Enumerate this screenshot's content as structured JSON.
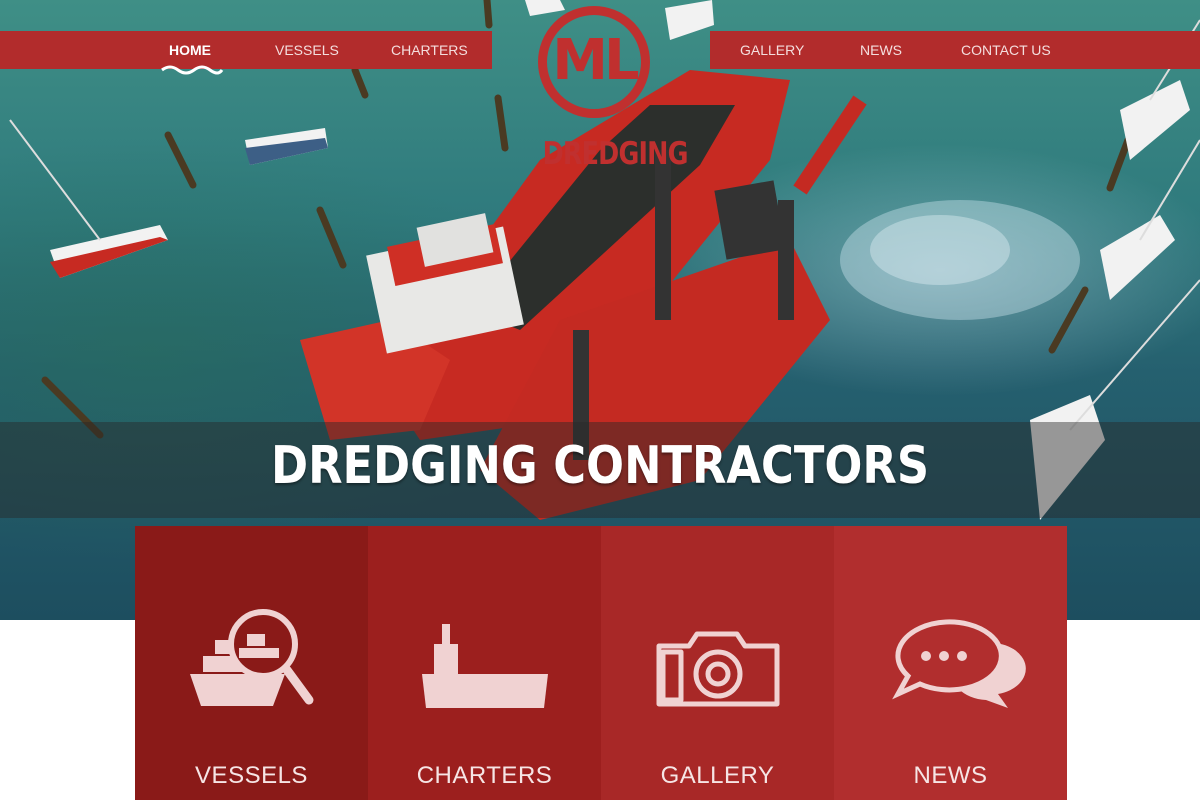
{
  "nav": {
    "left": [
      {
        "label": "HOME",
        "active": true
      },
      {
        "label": "VESSELS"
      },
      {
        "label": "CHARTERS"
      }
    ],
    "right": [
      {
        "label": "GALLERY"
      },
      {
        "label": "NEWS"
      },
      {
        "label": "CONTACT US"
      }
    ]
  },
  "logo": {
    "initials": "ML",
    "word": "DREDGING"
  },
  "hero": {
    "title": "DREDGING CONTRACTORS"
  },
  "tiles": [
    {
      "label": "VESSELS",
      "icon": "vessel-search-icon",
      "color": "#8a1a18"
    },
    {
      "label": "CHARTERS",
      "icon": "ship-icon",
      "color": "#9c1f1e"
    },
    {
      "label": "GALLERY",
      "icon": "camera-icon",
      "color": "#a82827"
    },
    {
      "label": "NEWS",
      "icon": "chat-bubbles-icon",
      "color": "#b12e2e"
    }
  ],
  "colors": {
    "brand": "#b22c2c",
    "logo": "#c0302f",
    "icon": "#f0d2d2"
  }
}
